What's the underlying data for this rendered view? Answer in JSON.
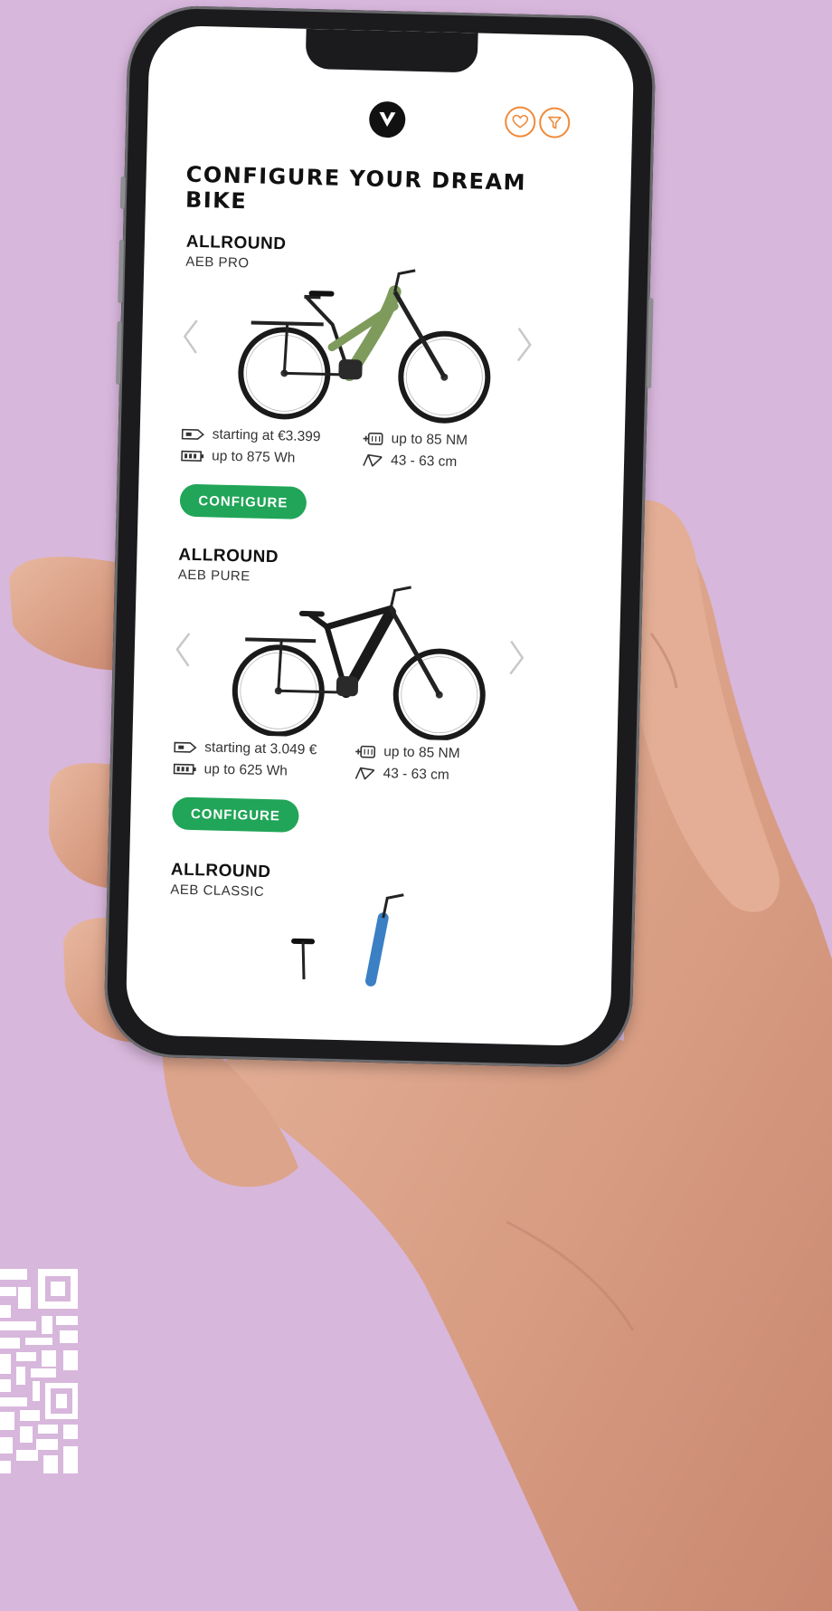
{
  "header": {
    "logo_icon": "v-logo-icon",
    "favorites_icon": "heart-icon",
    "filter_icon": "filter-icon",
    "accent_color": "#f08a3a"
  },
  "page": {
    "title": "CONFIGURE YOUR DREAM BIKE"
  },
  "bikes": [
    {
      "category": "ALLROUND",
      "model": "AEB PRO",
      "frame_color": "#7e9b5c",
      "price": "starting at €3.399",
      "battery": "up to 875 Wh",
      "torque": "up to 85 NM",
      "frame_size": "43 - 63 cm",
      "button_label": "CONFIGURE"
    },
    {
      "category": "ALLROUND",
      "model": "AEB PURE",
      "frame_color": "#1a1a1a",
      "price": "starting at 3.049 €",
      "battery": "up to 625 Wh",
      "torque": "up to 85 NM",
      "frame_size": "43 - 63 cm",
      "button_label": "CONFIGURE"
    },
    {
      "category": "ALLROUND",
      "model": "AEB CLASSIC",
      "frame_color": "#3b7fc4"
    }
  ],
  "colors": {
    "background": "#d8b7dc",
    "button": "#21a558"
  }
}
